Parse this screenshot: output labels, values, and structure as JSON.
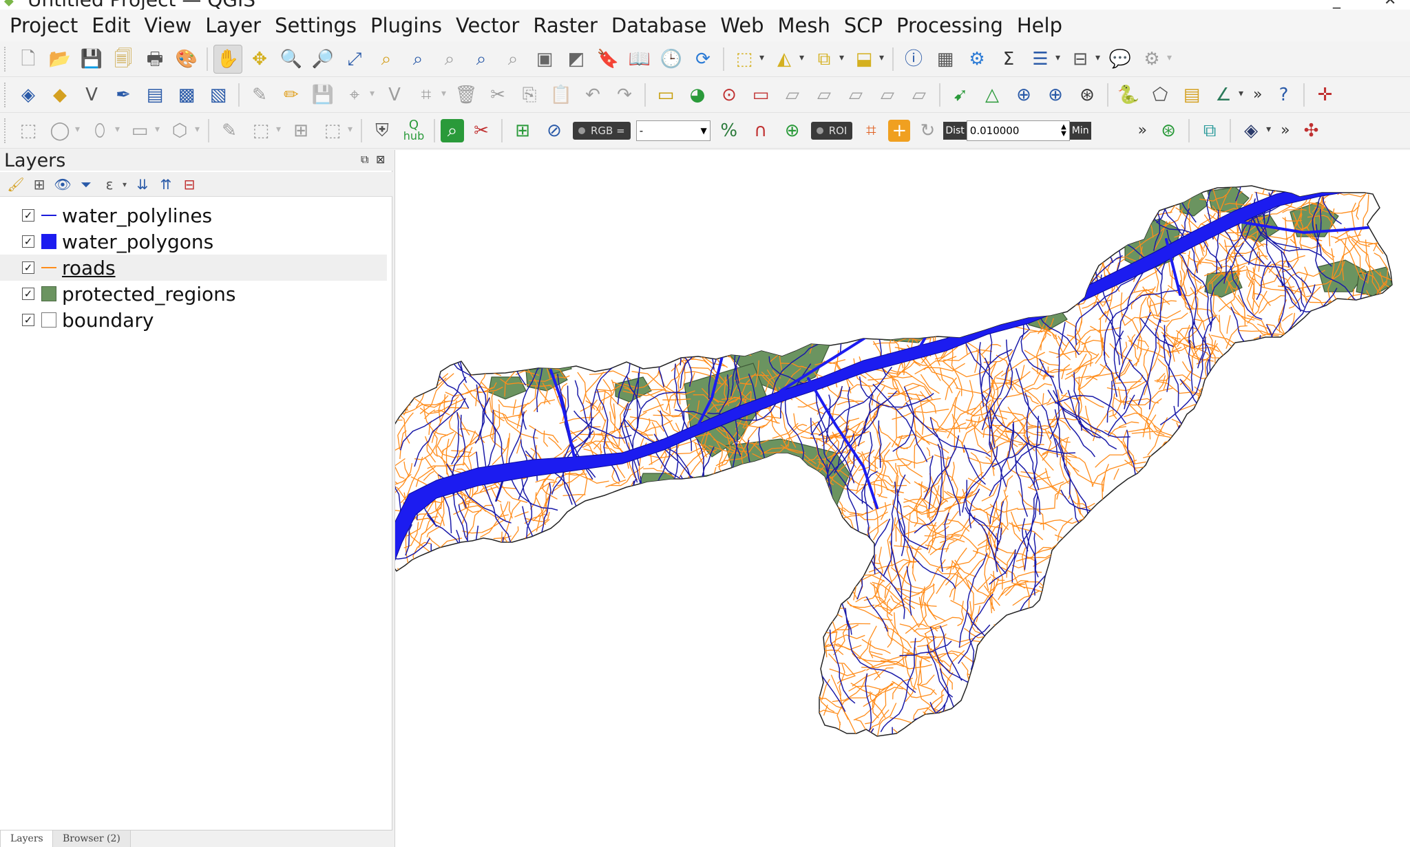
{
  "window": {
    "title": "Untitled Project — QGIS",
    "logo_icon": "qgis-logo-icon"
  },
  "menu": [
    "Project",
    "Edit",
    "View",
    "Layer",
    "Settings",
    "Plugins",
    "Vector",
    "Raster",
    "Database",
    "Web",
    "Mesh",
    "SCP",
    "Processing",
    "Help"
  ],
  "toolbar_scp": {
    "rgb_label": "RGB =",
    "rgb_value": "-",
    "roi_label": "ROI",
    "dist_label": "Dist",
    "dist_value": "0.010000",
    "min_label": "Min",
    "hub_label": "hub"
  },
  "layers_panel": {
    "title": "Layers",
    "layers": [
      {
        "name": "water_polylines",
        "checked": true,
        "symbol": "line",
        "color": "#1a1adb"
      },
      {
        "name": "water_polygons",
        "checked": true,
        "symbol": "fill",
        "color": "#1c1cf0"
      },
      {
        "name": "roads",
        "checked": true,
        "symbol": "line",
        "color": "#ff8c1a",
        "selected": true
      },
      {
        "name": "protected_regions",
        "checked": true,
        "symbol": "fill",
        "color": "#6b9460"
      },
      {
        "name": "boundary",
        "checked": true,
        "symbol": "fill",
        "color": "#ffffff"
      }
    ],
    "tabs": [
      "Layers",
      "Browser (2)"
    ],
    "check_glyph": "✓"
  },
  "map_colors": {
    "boundary_fill": "#ffffff",
    "boundary_stroke": "#222222",
    "protected": "#6b9460",
    "water": "#1c1cf0",
    "water_lines": "#1a1aa8",
    "roads": "#ff8c1a"
  }
}
